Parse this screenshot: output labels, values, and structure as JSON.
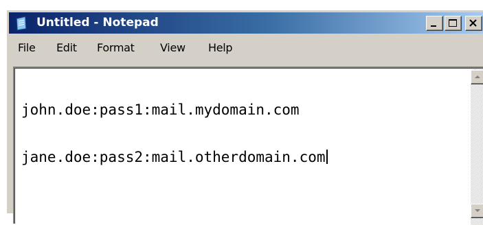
{
  "window": {
    "title": "Untitled - Notepad",
    "app_icon": "notepad-icon",
    "controls": {
      "minimize_icon": "minimize-icon",
      "maximize_icon": "maximize-icon",
      "close_icon": "close-icon"
    },
    "titlebar_colors": [
      "#0a246a",
      "#3a6ea5",
      "#a6caf0"
    ]
  },
  "menu": {
    "items": [
      {
        "label": "File"
      },
      {
        "label": "Edit"
      },
      {
        "label": "Format"
      },
      {
        "label": "View"
      },
      {
        "label": "Help"
      }
    ]
  },
  "editor": {
    "lines": [
      "john.doe:pass1:mail.mydomain.com",
      "jane.doe:pass2:mail.otherdomain.com"
    ]
  },
  "scrollbar": {
    "up_icon": "scroll-up-arrow-icon",
    "down_icon": "scroll-down-arrow-icon"
  }
}
